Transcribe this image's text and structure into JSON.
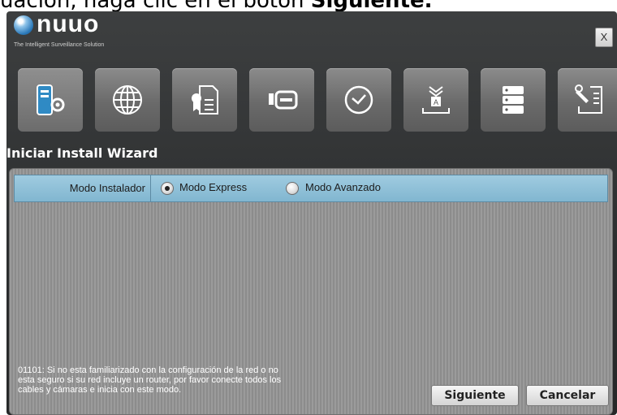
{
  "caption": {
    "prefix": "uación, haga clic en el botón ",
    "bold": "Siguiente."
  },
  "app": {
    "logo_text": "nuuo",
    "tagline": "The Intelligent Surveillance Solution",
    "close_label": "X"
  },
  "toolbar": {
    "icons": [
      "server-settings-icon",
      "globe-icon",
      "license-certificate-icon",
      "card-reader-icon",
      "clock-icon",
      "install-download-icon",
      "storage-drive-icon",
      "tools-icon"
    ]
  },
  "wizard": {
    "title": "Iniciar Install Wizard",
    "mode_label": "Modo Instalador",
    "options": [
      {
        "label": "Modo Express",
        "selected": true
      },
      {
        "label": "Modo Avanzado",
        "selected": false
      }
    ],
    "note_line1": "01101: Si no esta familiarizado con la configuración de la red o no",
    "note_line2": "esta seguro si su red incluye un router,  por favor conecte todos los",
    "note_line3": "cables y cámaras e inicia con este modo.",
    "next_label": "Siguiente",
    "cancel_label": "Cancelar"
  }
}
